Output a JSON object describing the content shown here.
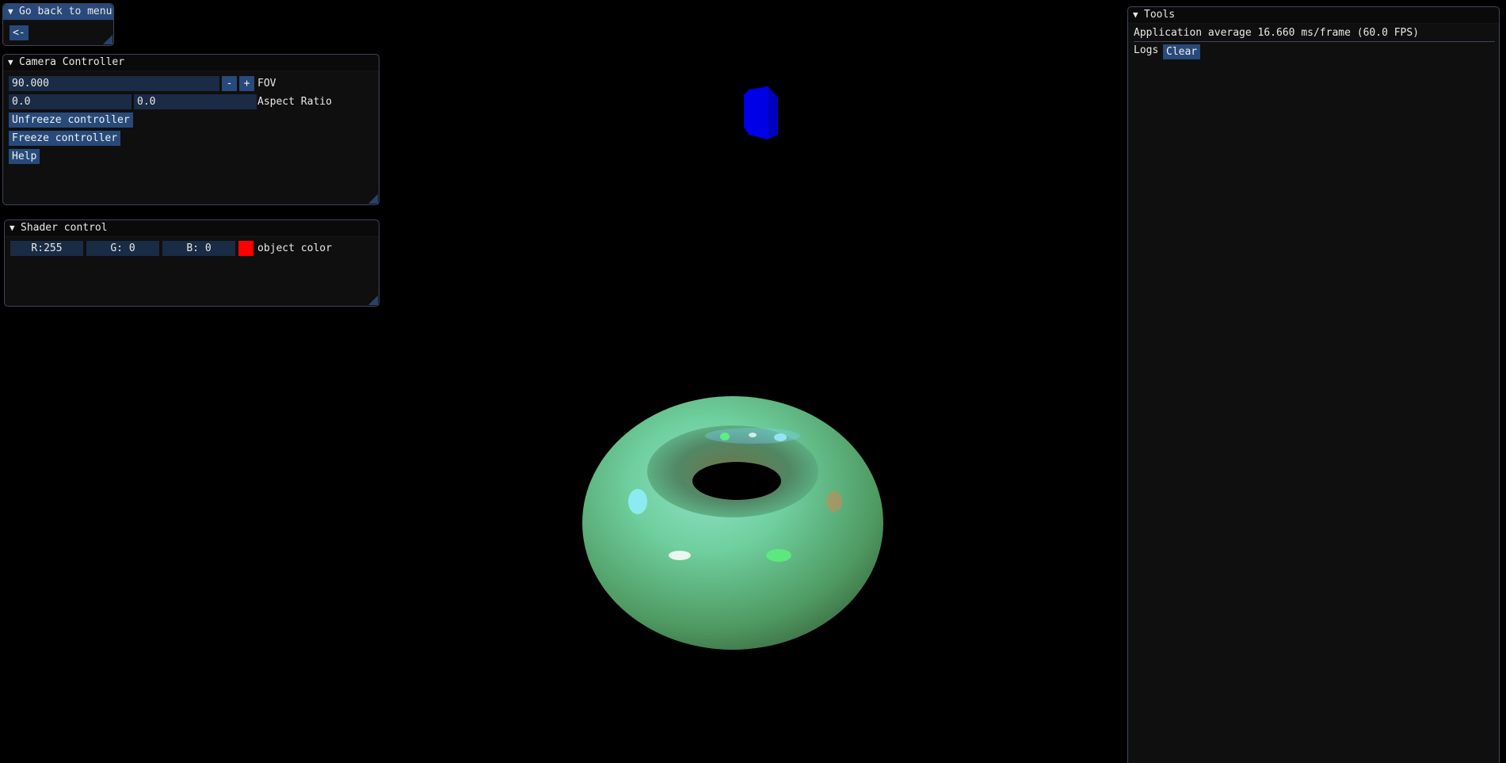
{
  "menu_window": {
    "title": "Go back to menu",
    "back_label": "<-"
  },
  "camera": {
    "title": "Camera Controller",
    "fov_value": "90.000",
    "minus_label": "-",
    "plus_label": "+",
    "fov_label": "FOV",
    "aspect_x": "0.0",
    "aspect_y": "0.0",
    "aspect_label": "Aspect Ratio",
    "unfreeze_label": "Unfreeze controller",
    "freeze_label": "Freeze controller",
    "help_label": "Help"
  },
  "shader": {
    "title": "Shader control",
    "r_text": "R:255",
    "g_text": "G:  0",
    "b_text": "B:  0",
    "swatch_color": "#ff0000",
    "color_label": "object color"
  },
  "tools": {
    "title": "Tools",
    "fps_text": "Application average 16.660 ms/frame (60.0 FPS)",
    "logs_label": "Logs",
    "clear_label": "Clear"
  },
  "colors": {
    "title_active": "#29497a",
    "button": "#274a7a",
    "field": "#1a2b45",
    "cube": "#0000e0",
    "torus": "#5fc48a"
  }
}
